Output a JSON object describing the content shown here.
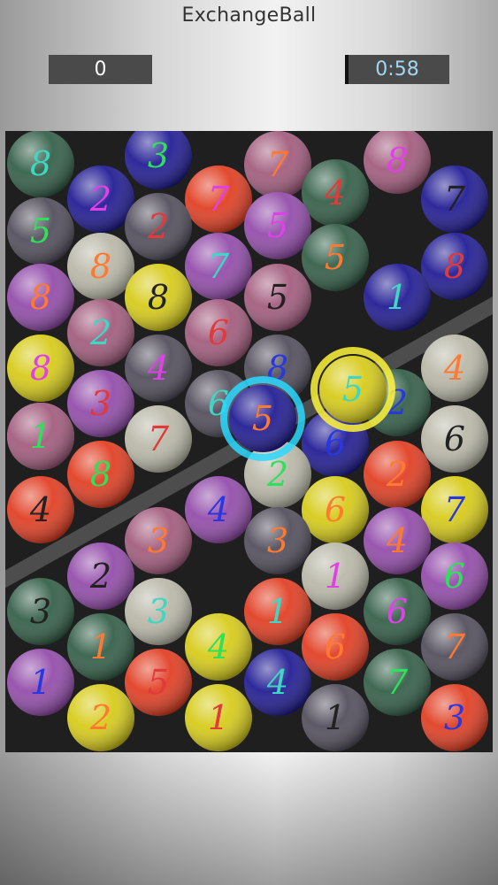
{
  "app": {
    "title": "ExchangeBall"
  },
  "hud": {
    "score": "0",
    "timer": "0:58",
    "timer_color": "#9fd8f2"
  },
  "board": {
    "background": "#1f1f1f",
    "line_color": "#4d4d4d",
    "balls": [
      {
        "num": "8",
        "color": "#2f5b44",
        "numColor": "#3fd6c4"
      },
      {
        "num": "3",
        "color": "#1c1791",
        "numColor": "#2fe05a"
      },
      {
        "num": "7",
        "color": "#a0587a",
        "numColor": "#ff7a30"
      },
      {
        "num": "8",
        "color": "#a0587a",
        "numColor": "#e040e8"
      },
      {
        "num": "2",
        "color": "#1c1791",
        "numColor": "#e040e8"
      },
      {
        "num": "7",
        "color": "#e03a1e",
        "numColor": "#e040e8"
      },
      {
        "num": "4",
        "color": "#2f5b44",
        "numColor": "#e03a3a"
      },
      {
        "num": "7",
        "color": "#1c1791",
        "numColor": "#222222"
      },
      {
        "num": "5",
        "color": "#4e4a58",
        "numColor": "#2fe05a"
      },
      {
        "num": "2",
        "color": "#4e4a58",
        "numColor": "#e03a3a"
      },
      {
        "num": "5",
        "color": "#9048a8",
        "numColor": "#e040e8"
      },
      {
        "num": "8",
        "color": "#b8b6a6",
        "numColor": "#ff7a30"
      },
      {
        "num": "7",
        "color": "#9048a8",
        "numColor": "#3fd6c4"
      },
      {
        "num": "5",
        "color": "#2f5b44",
        "numColor": "#ff7a30"
      },
      {
        "num": "8",
        "color": "#1c1791",
        "numColor": "#e03a3a"
      },
      {
        "num": "8",
        "color": "#9048a8",
        "numColor": "#ff7a30"
      },
      {
        "num": "8",
        "color": "#d6ca14",
        "numColor": "#222222"
      },
      {
        "num": "5",
        "color": "#a0587a",
        "numColor": "#222222"
      },
      {
        "num": "1",
        "color": "#1c1791",
        "numColor": "#3fd6c4"
      },
      {
        "num": "2",
        "color": "#a0587a",
        "numColor": "#3fd6c4"
      },
      {
        "num": "6",
        "color": "#a0587a",
        "numColor": "#e03a3a"
      },
      {
        "num": "8",
        "color": "#d6ca14",
        "numColor": "#e040e8"
      },
      {
        "num": "4",
        "color": "#4e4a58",
        "numColor": "#e040e8"
      },
      {
        "num": "8",
        "color": "#4e4a58",
        "numColor": "#2838e0"
      },
      {
        "num": "4",
        "color": "#b8b6a6",
        "numColor": "#ff7a30"
      },
      {
        "num": "3",
        "color": "#9048a8",
        "numColor": "#e03a3a"
      },
      {
        "num": "6",
        "color": "#4e4a58",
        "numColor": "#3fd6c4"
      },
      {
        "num": "5",
        "color": "#b8b6a6",
        "numColor": "#2838e0"
      },
      {
        "num": "2",
        "color": "#2f5b44",
        "numColor": "#2838e0"
      },
      {
        "num": "1",
        "color": "#a0587a",
        "numColor": "#2fe05a"
      },
      {
        "num": "7",
        "color": "#b8b6a6",
        "numColor": "#e03a3a"
      },
      {
        "num": "6",
        "color": "#1c1791",
        "numColor": "#2838e0"
      },
      {
        "num": "6",
        "color": "#b8b6a6",
        "numColor": "#222222"
      },
      {
        "num": "8",
        "color": "#e03a1e",
        "numColor": "#2fe05a"
      },
      {
        "num": "2",
        "color": "#b8b6a6",
        "numColor": "#2fe05a"
      },
      {
        "num": "2",
        "color": "#e03a1e",
        "numColor": "#ff7a30"
      },
      {
        "num": "4",
        "color": "#e03a1e",
        "numColor": "#222222"
      },
      {
        "num": "4",
        "color": "#9048a8",
        "numColor": "#2838e0"
      },
      {
        "num": "6",
        "color": "#d6ca14",
        "numColor": "#ff7a30"
      },
      {
        "num": "7",
        "color": "#d6ca14",
        "numColor": "#2838e0"
      },
      {
        "num": "3",
        "color": "#a0587a",
        "numColor": "#ff7a30"
      },
      {
        "num": "3",
        "color": "#4e4a58",
        "numColor": "#ff7a30"
      },
      {
        "num": "4",
        "color": "#9048a8",
        "numColor": "#ff7a30"
      },
      {
        "num": "2",
        "color": "#9048a8",
        "numColor": "#222222"
      },
      {
        "num": "1",
        "color": "#b8b6a6",
        "numColor": "#e040e8"
      },
      {
        "num": "6",
        "color": "#9048a8",
        "numColor": "#2fe05a"
      },
      {
        "num": "3",
        "color": "#2f5b44",
        "numColor": "#222222"
      },
      {
        "num": "3",
        "color": "#b8b6a6",
        "numColor": "#3fd6c4"
      },
      {
        "num": "1",
        "color": "#e03a1e",
        "numColor": "#3fd6c4"
      },
      {
        "num": "6",
        "color": "#2f5b44",
        "numColor": "#e040e8"
      },
      {
        "num": "1",
        "color": "#2f5b44",
        "numColor": "#ff7a30"
      },
      {
        "num": "4",
        "color": "#d6ca14",
        "numColor": "#2fe05a"
      },
      {
        "num": "6",
        "color": "#e03a1e",
        "numColor": "#ff7a30"
      },
      {
        "num": "7",
        "color": "#4e4a58",
        "numColor": "#ff7a30"
      },
      {
        "num": "1",
        "color": "#9048a8",
        "numColor": "#2838e0"
      },
      {
        "num": "5",
        "color": "#e03a1e",
        "numColor": "#e03a3a"
      },
      {
        "num": "4",
        "color": "#1c1791",
        "numColor": "#3fd6c4"
      },
      {
        "num": "7",
        "color": "#2f5b44",
        "numColor": "#2fe05a"
      },
      {
        "num": "2",
        "color": "#d6ca14",
        "numColor": "#ff7a30"
      },
      {
        "num": "1",
        "color": "#d6ca14",
        "numColor": "#e03a3a"
      },
      {
        "num": "1",
        "color": "#4e4a58",
        "numColor": "#222222"
      },
      {
        "num": "3",
        "color": "#e03a1e",
        "numColor": "#2838e0"
      }
    ],
    "selected": [
      {
        "num": "5",
        "color": "#1c1791",
        "numColor": "#ff7a30",
        "glow": "#2ad8ff"
      },
      {
        "num": "5",
        "color": "#d6ca14",
        "numColor": "#3fd6c4",
        "glow": "#fff43a"
      }
    ]
  }
}
